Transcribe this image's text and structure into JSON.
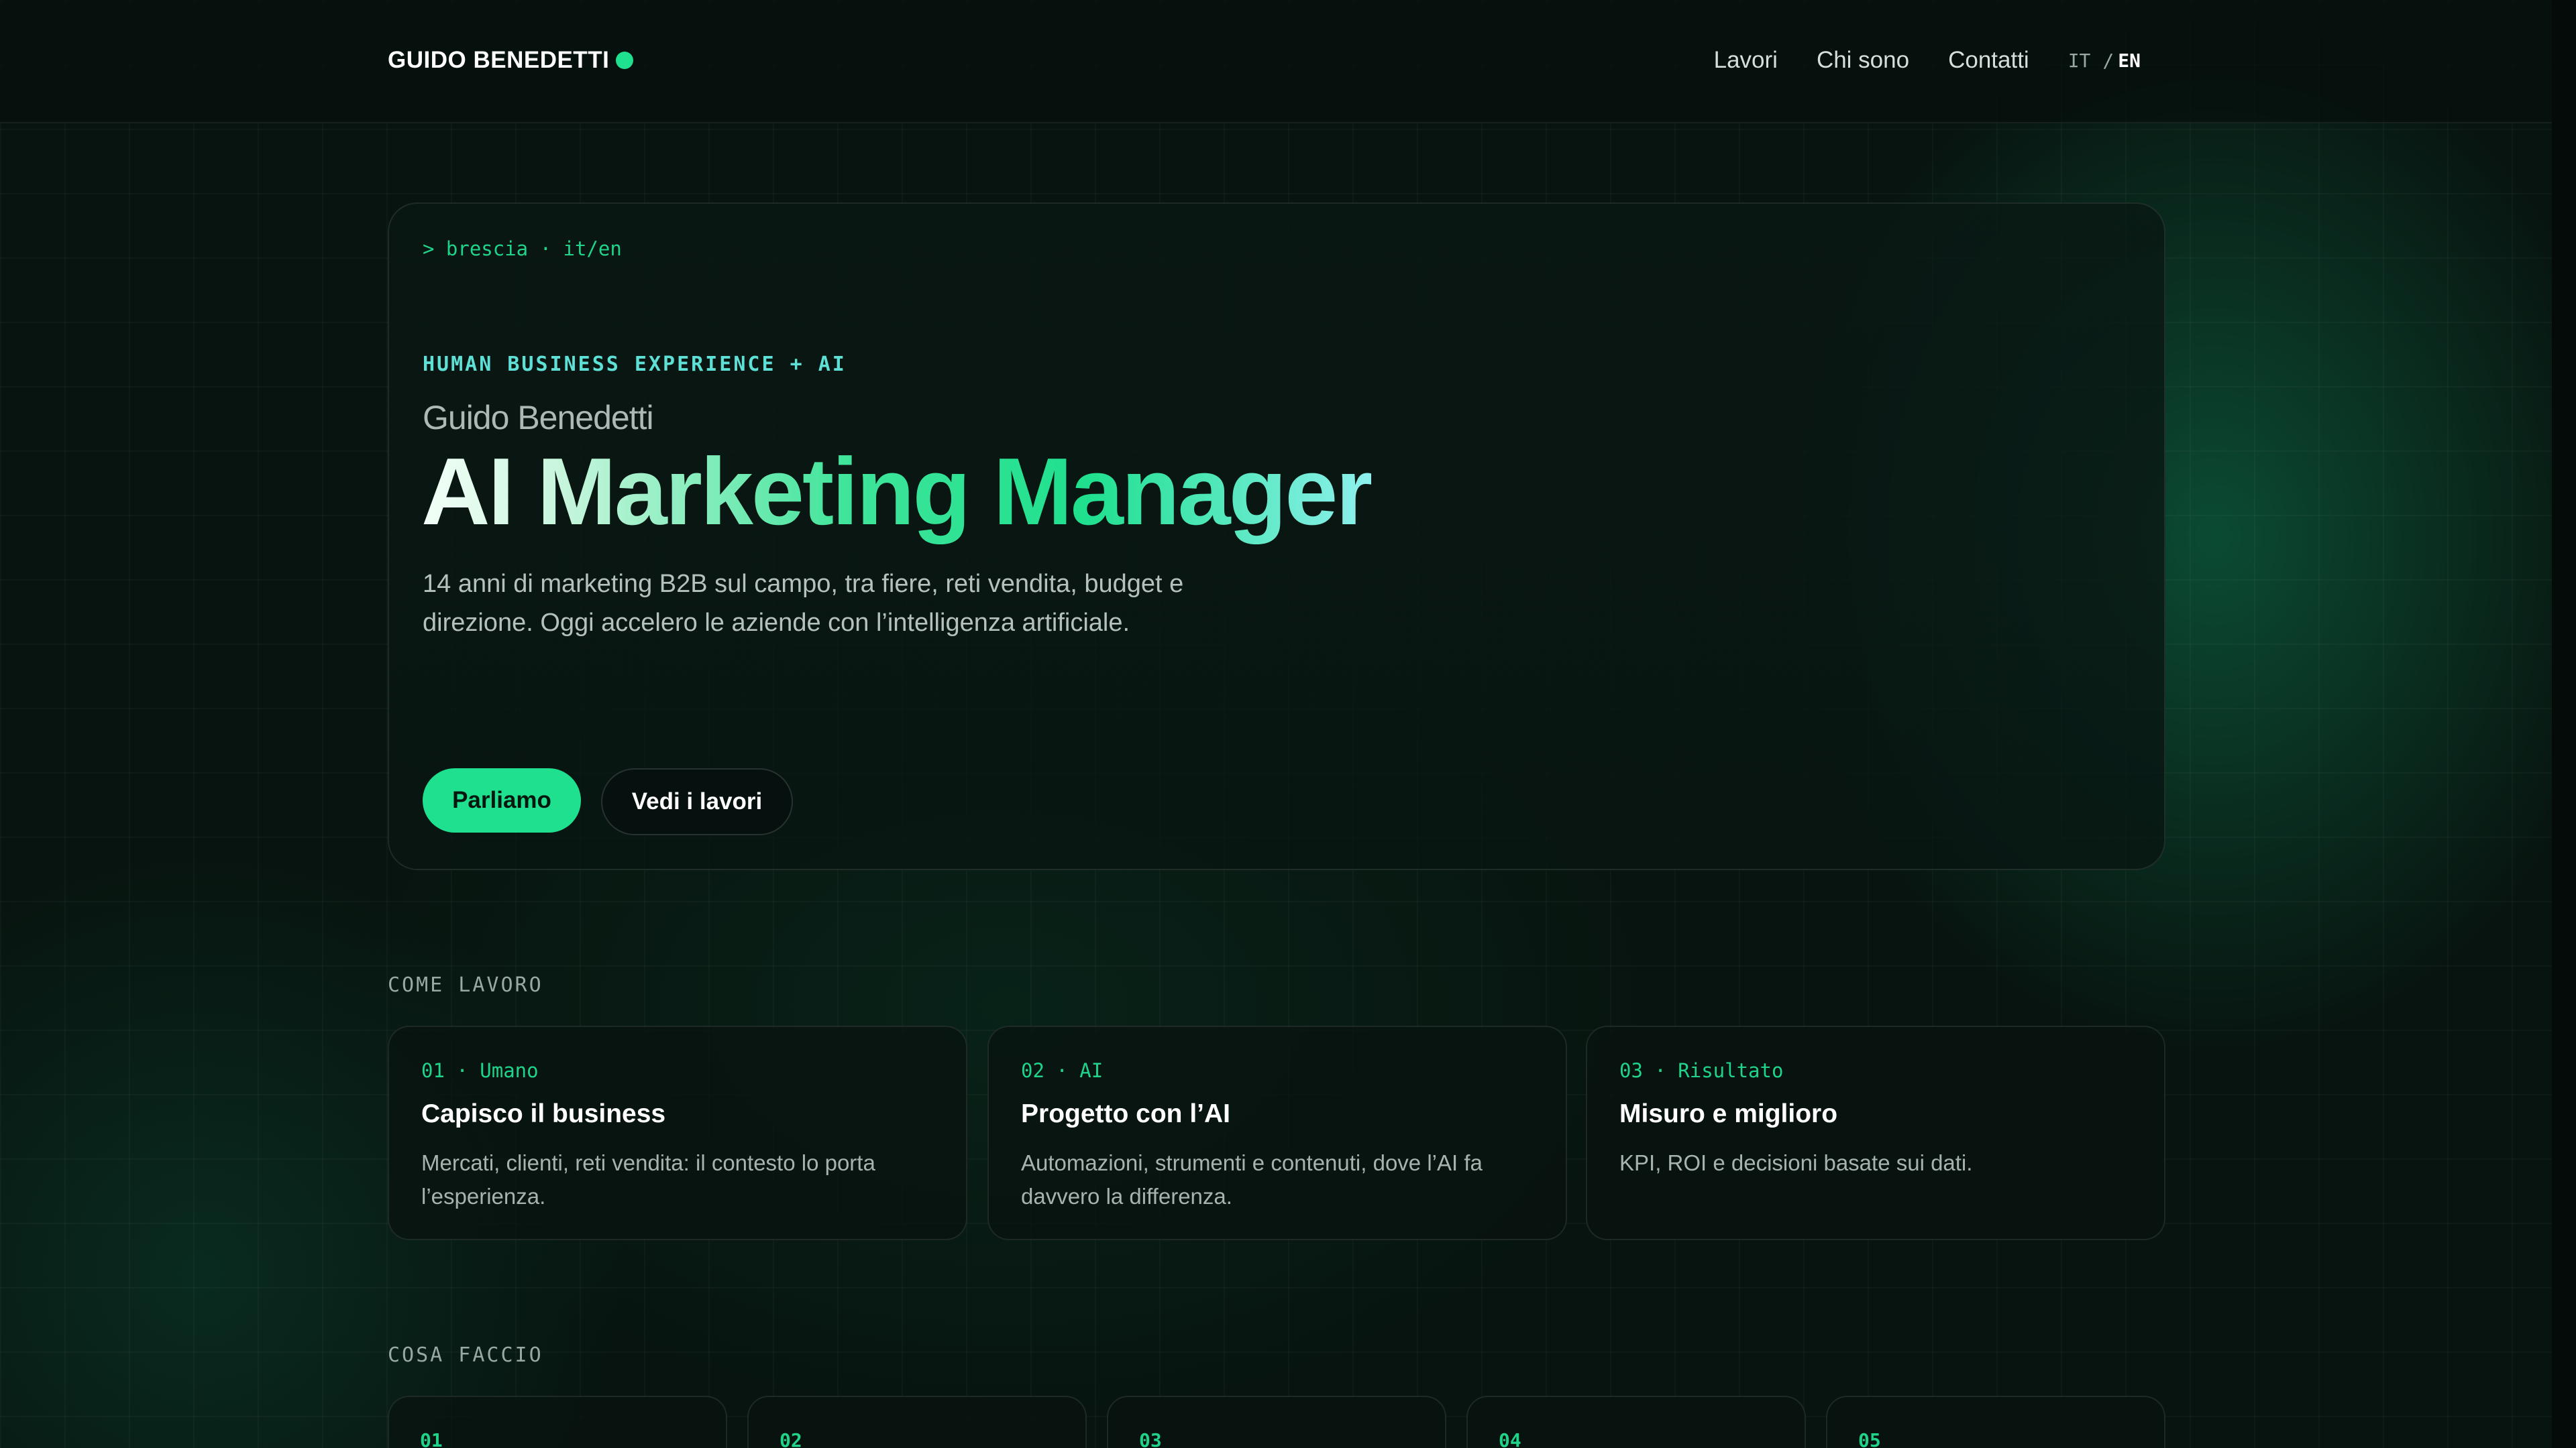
{
  "header": {
    "brand": "GUIDO BENEDETTI",
    "nav": [
      "Lavori",
      "Chi sono",
      "Contatti"
    ],
    "lang": {
      "it": "IT",
      "sep": "/",
      "en": "EN",
      "active": "EN"
    }
  },
  "hero": {
    "prompt": "> brescia · it/en",
    "eyebrow": "HUMAN BUSINESS EXPERIENCE + AI",
    "name": "Guido Benedetti",
    "title": "AI Marketing Manager",
    "lead": "14 anni di marketing B2B sul campo, tra fiere, reti vendita, budget e direzione. Oggi accelero le aziende con l’intelligenza artificiale.",
    "cta_primary": "Parliamo",
    "cta_secondary": "Vedi i lavori"
  },
  "how": {
    "label": "COME LAVORO",
    "steps": [
      {
        "tag": "01 · Umano",
        "title": "Capisco il business",
        "desc": "Mercati, clienti, reti vendita: il contesto lo porta l’esperienza."
      },
      {
        "tag": "02 · AI",
        "title": "Progetto con l’AI",
        "desc": "Automazioni, strumenti e contenuti, dove l’AI fa davvero la differenza."
      },
      {
        "tag": "03 · Risultato",
        "title": "Misuro e miglioro",
        "desc": "KPI, ROI e decisioni basate sui dati."
      }
    ]
  },
  "services": {
    "label": "COSA FACCIO",
    "items": [
      {
        "num": "01"
      },
      {
        "num": "02"
      },
      {
        "num": "03"
      },
      {
        "num": "04"
      },
      {
        "num": "05"
      }
    ]
  },
  "colors": {
    "accent": "#1fe08e",
    "eyebrow": "#5ee0d6",
    "background": "#07110e"
  }
}
